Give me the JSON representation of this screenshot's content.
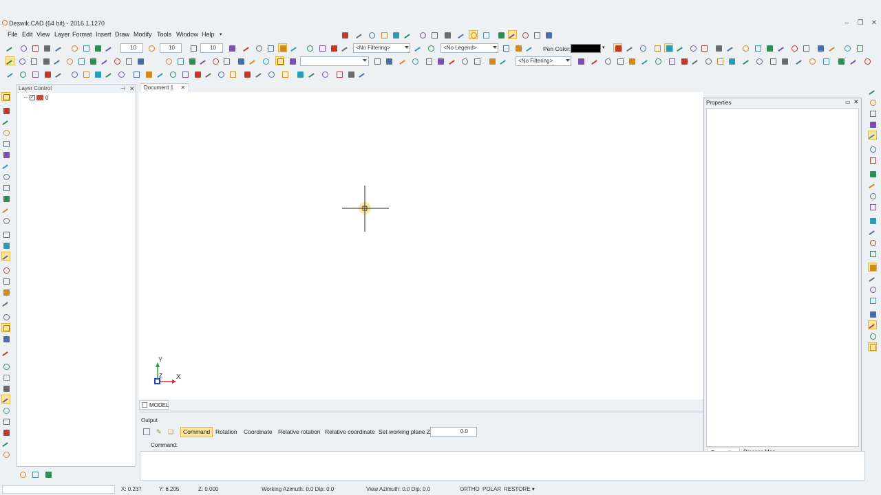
{
  "app": {
    "title": "Deswik.CAD (64 bit) - 2016.1.1270",
    "window_buttons": [
      "‒",
      "❐",
      "✕"
    ]
  },
  "menu": [
    "File",
    "Edit",
    "View",
    "Layer",
    "Format",
    "Insert",
    "Draw",
    "Modify",
    "Tools",
    "Window",
    "Help"
  ],
  "toolbar1": {
    "size1": "10",
    "size2": "10",
    "size3": "10",
    "filter": "<No Filtering>",
    "legend": "<No Legend>",
    "pen_color_label": "Pen Color:",
    "pen_color": "#000000"
  },
  "toolbar2": {
    "filter": "<No Filtering>"
  },
  "layer_panel": {
    "title": "Layer Control",
    "layer_name": "0"
  },
  "document": {
    "tab": "Document 1",
    "model_tab": "MODEL",
    "axis_y": "Y",
    "axis_x": "X",
    "axis_z": "Z"
  },
  "properties": {
    "title": "Properties",
    "tabs": [
      "Properties",
      "Process Map"
    ]
  },
  "output": {
    "title": "Output",
    "buttons": [
      "Command",
      "Rotation",
      "Coordinate",
      "Relative rotation",
      "Relative coordinate",
      "Set working plane Z"
    ],
    "working_plane_z": "0.0",
    "command_label": "Command:"
  },
  "status": {
    "x": "X: 0.237",
    "y": "Y: 6.205",
    "z": "Z: 0.000",
    "working": "Working  Azimuth: 0.0   Dip: 0.0",
    "view": "View  Azimuth: 0.0   Dip: 0.0",
    "ortho": "ORTHO",
    "polar": "POLAR",
    "restore": "RESTORE ▾"
  },
  "colors": {
    "highlight": "#fde59a",
    "accent_orange": "#e3b444",
    "axis_x": "#d32f2f",
    "axis_y": "#2e9e3a",
    "axis_z": "#1c3fd6"
  },
  "icons": [
    "line-icon",
    "zoom-icon",
    "layer-icon",
    "snap-icon",
    "pen-icon",
    "circle-icon",
    "crosshair-icon",
    "close-icon",
    "pin-icon"
  ]
}
